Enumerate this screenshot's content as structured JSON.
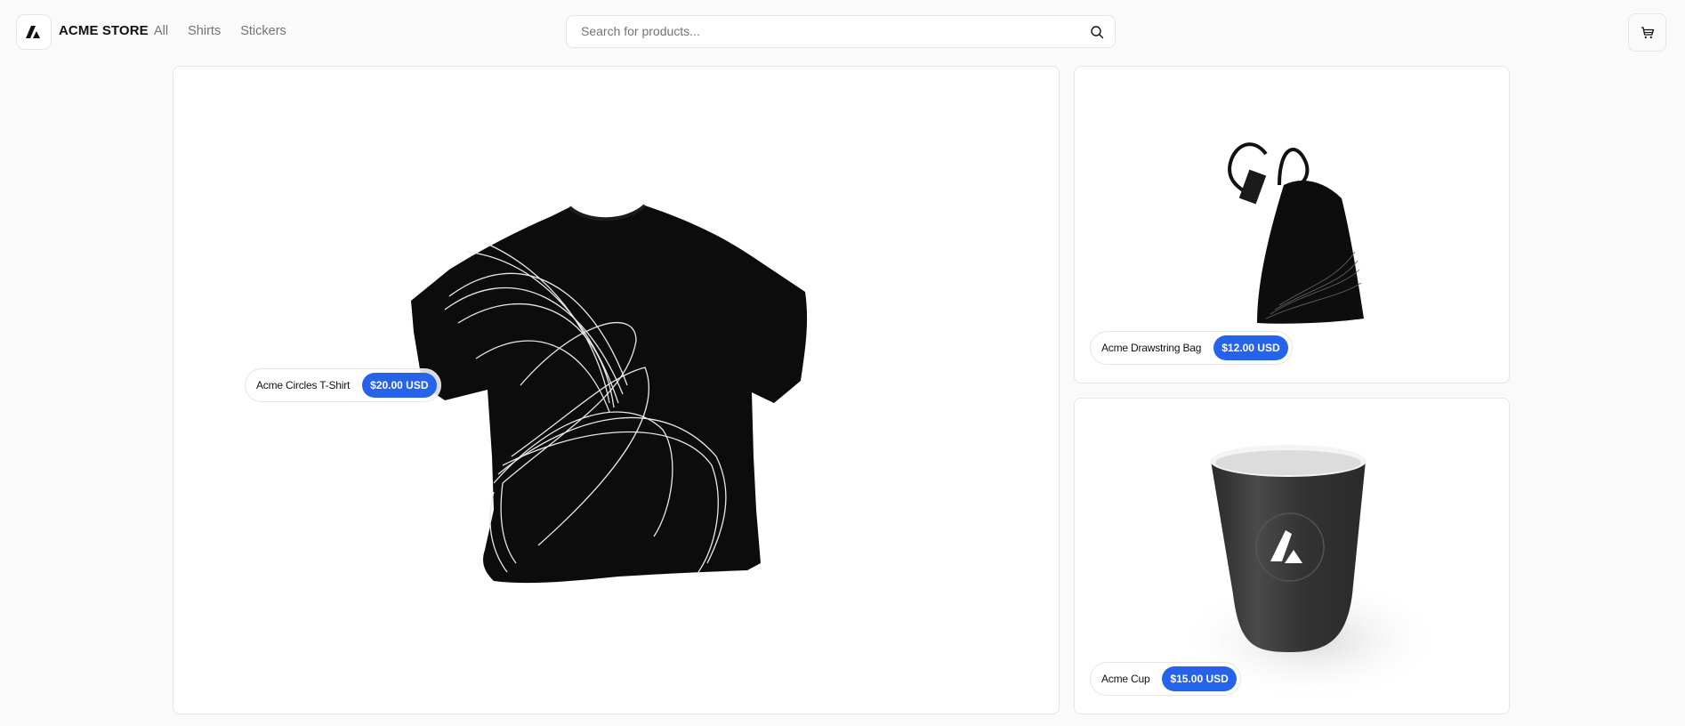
{
  "header": {
    "brand": "ACME STORE",
    "logo_icon": "acme-logo-icon",
    "nav": [
      {
        "label": "All"
      },
      {
        "label": "Shirts"
      },
      {
        "label": "Stickers"
      }
    ],
    "search": {
      "placeholder": "Search for products...",
      "value": "",
      "icon": "search-icon"
    },
    "cart_icon": "cart-icon"
  },
  "products": [
    {
      "name": "Acme Circles T-Shirt",
      "price": "$20.00 USD",
      "image": "t-shirt-image"
    },
    {
      "name": "Acme Drawstring Bag",
      "price": "$12.00 USD",
      "image": "drawstring-bag-image"
    },
    {
      "name": "Acme Cup",
      "price": "$15.00 USD",
      "image": "cup-image"
    }
  ],
  "colors": {
    "accent": "#2563eb",
    "background": "#fafafa",
    "border": "#e5e5e5",
    "muted_text": "#737373"
  }
}
